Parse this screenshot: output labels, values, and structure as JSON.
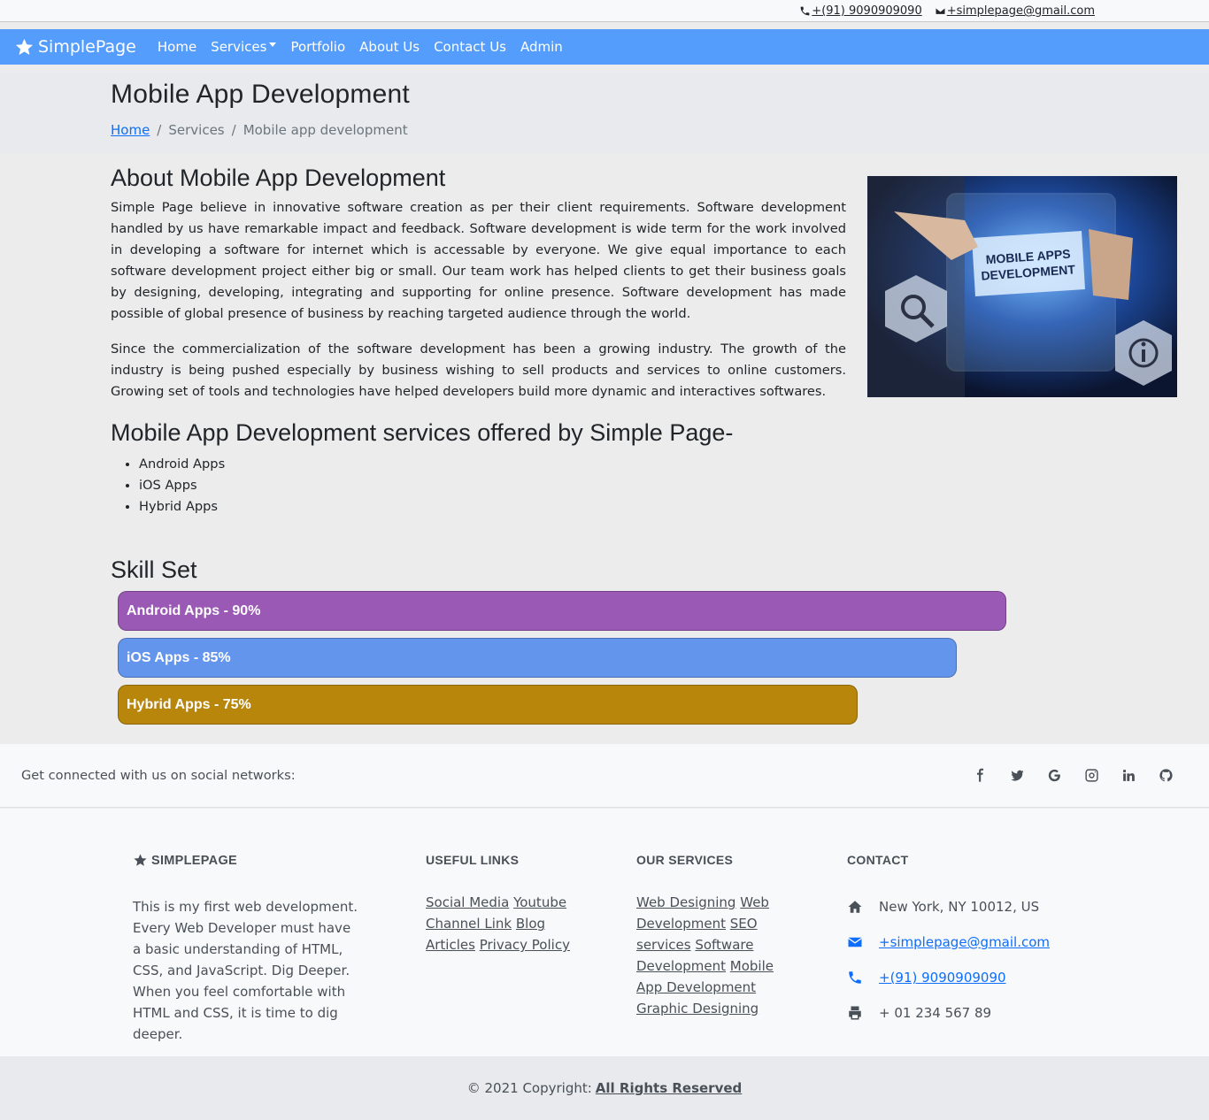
{
  "topbar": {
    "phone": "+(91) 9090909090",
    "email": "+simplepage@gmail.com"
  },
  "nav": {
    "brand": "SimplePage",
    "links": [
      "Home",
      "Services",
      "Portfolio",
      "About Us",
      "Contact Us",
      "Admin"
    ]
  },
  "hero": {
    "title": "Mobile App Development",
    "breadcrumb": [
      "Home",
      "Services",
      "Mobile app development"
    ]
  },
  "about": {
    "title": "About Mobile App Development",
    "p1": "Simple Page believe in innovative software creation as per their client requirements. Software development handled by us have remarkable impact and feedback. Software development is wide term for the work involved in developing a software for internet which is accessable by everyone. We give equal importance to each software development project either big or small. Our team work has helped clients to get their business goals by designing, developing, integrating and supporting for online presence. Software development has made possible of global presence of business by reaching targeted audience through the world.",
    "p2": "Since the commercialization of the software development has been a growing industry. The growth of the industry is being pushed especially by business wishing to sell products and services to online customers. Growing set of tools and technologies have helped developers build more dynamic and interactives softwares.",
    "image_text": [
      "MOBILE APPS",
      "DEVELOPMENT"
    ]
  },
  "services": {
    "title": "Mobile App Development services offered by Simple Page-",
    "items": [
      "Android Apps",
      "iOS Apps",
      "Hybrid Apps"
    ]
  },
  "skills": {
    "title": "Skill Set",
    "bars": [
      {
        "label": "Android Apps - 90%",
        "value": 90,
        "color": "#9b59b6"
      },
      {
        "label": "iOS Apps - 85%",
        "value": 85,
        "color": "#6495ed"
      },
      {
        "label": "Hybrid Apps - 75%",
        "value": 75,
        "color": "#b8860b"
      }
    ]
  },
  "social": {
    "text": "Get connected with us on social networks:"
  },
  "footer": {
    "brand": "SIMPLEPAGE",
    "about": "This is my first web development. Every Web Developer must have a basic understanding of HTML, CSS, and JavaScript. Dig Deeper. When you feel comfortable with HTML and CSS, it is time to dig deeper.",
    "useful_title": "Useful links",
    "useful": [
      "Social Media",
      "Youtube Channel Link",
      "Blog Articles",
      "Privacy Policy"
    ],
    "services_title": "Our Services",
    "services": [
      "Web Designing",
      "Web Development",
      "SEO services",
      "Software Development",
      "Mobile App Development",
      "Graphic Designing"
    ],
    "contact_title": "Contact",
    "address": "New York, NY 10012, US",
    "email": "+simplepage@gmail.com",
    "phone": "+(91) 9090909090",
    "fax": "+ 01 234 567 89"
  },
  "copyright": {
    "text": "© 2021 Copyright:",
    "link": "All Rights Reserved"
  }
}
